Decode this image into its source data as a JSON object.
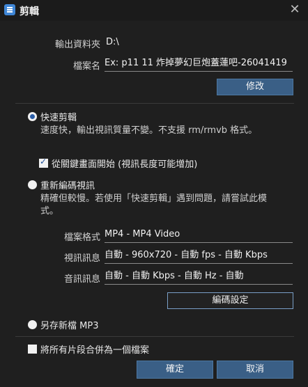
{
  "window": {
    "title": "剪輯",
    "close_icon": "close-icon"
  },
  "output": {
    "folder_label": "輸出資料夾",
    "folder_value": "D:\\",
    "filename_label": "檔案名",
    "filename_value": "Ex: p11 11 炸掉夢幻巨炮蓋蓮吧-26041419",
    "modify_button": "修改"
  },
  "fast_cut": {
    "label": "快速剪輯",
    "selected": true,
    "desc": "速度快，輸出視訊質量不變。不支援 rm/rmvb 格式。",
    "keyframe_label": "從關鍵畫面開始 (視訊長度可能增加)",
    "keyframe_checked": true
  },
  "reencode": {
    "label": "重新編碼視訊",
    "selected": false,
    "desc": "精確但較慢。若使用「快速剪輯」遇到問題，請嘗試此模式。",
    "format_label": "檔案格式",
    "format_value": "MP4 - MP4 Video",
    "video_label": "視訊訊息",
    "video_value": "自動 - 960x720 - 自動 fps - 自動 Kbps",
    "audio_label": "音訊訊息",
    "audio_value": "自動 - 自動 Kbps - 自動 Hz - 自動",
    "encode_settings_button": "編碼設定"
  },
  "mp3": {
    "label": "另存新檔 MP3",
    "selected": false
  },
  "merge": {
    "label": "將所有片段合併為一個檔案",
    "checked": false
  },
  "footer": {
    "ok_button": "確定",
    "cancel_button": "取消"
  },
  "colors": {
    "accent": "#3a5f86",
    "background": "#1f1f1f"
  }
}
